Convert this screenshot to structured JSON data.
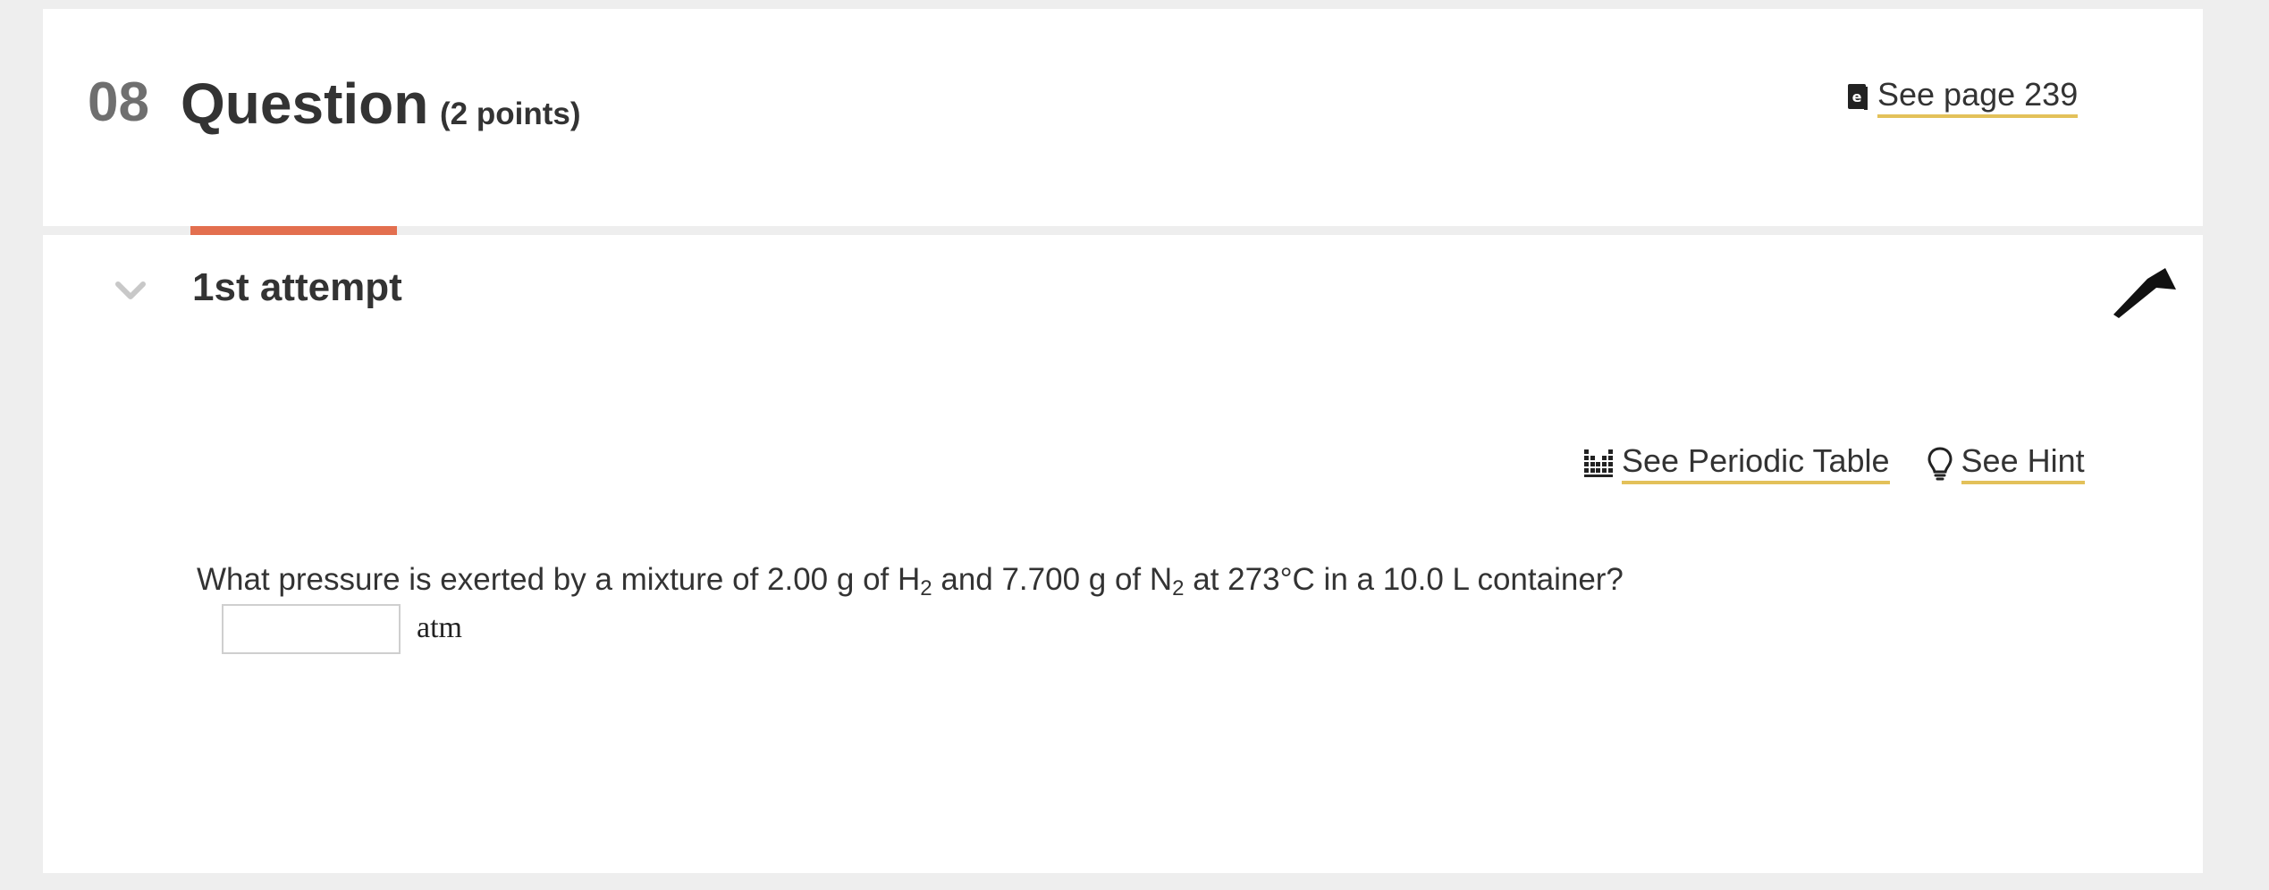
{
  "header": {
    "question_number": "08",
    "title": "Question",
    "points": "(2 points)",
    "see_page_label": "See page 239"
  },
  "attempt": {
    "title": "1st attempt"
  },
  "tools": {
    "periodic_table_label": "See Periodic Table",
    "hint_label": "See Hint"
  },
  "question": {
    "part1": "What pressure is exerted by a mixture of 2.00  g of H",
    "sub1": "2",
    "part2": " and 7.700  g of N",
    "sub2": "2",
    "part3": " at 273°C in a 10.0 L container?",
    "input_value": "",
    "unit": "atm"
  },
  "colors": {
    "accent_tab": "#e36f4f",
    "link_underline": "#e3c15a",
    "background": "#eeeeee"
  }
}
